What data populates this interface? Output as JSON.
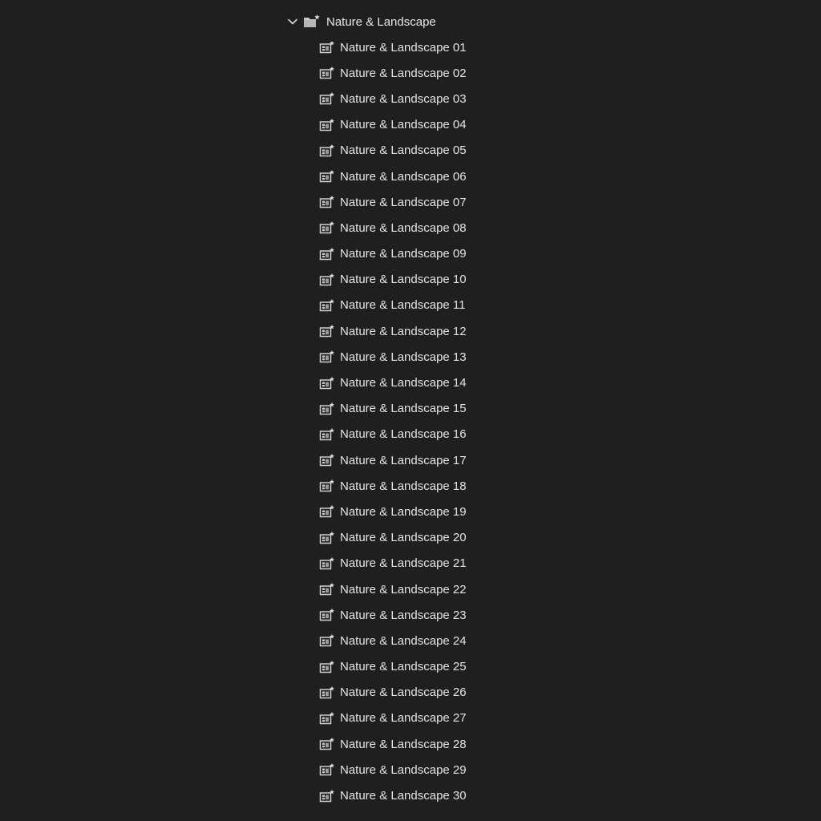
{
  "group": {
    "label": "Nature & Landscape",
    "expanded": true,
    "chevron_icon": "chevron-down-icon",
    "folder_icon": "preset-folder-star-icon"
  },
  "presets": [
    {
      "label": "Nature & Landscape 01"
    },
    {
      "label": "Nature & Landscape 02"
    },
    {
      "label": "Nature & Landscape 03"
    },
    {
      "label": "Nature & Landscape 04"
    },
    {
      "label": "Nature & Landscape 05"
    },
    {
      "label": "Nature & Landscape 06"
    },
    {
      "label": "Nature & Landscape 07"
    },
    {
      "label": "Nature & Landscape 08"
    },
    {
      "label": "Nature & Landscape 09"
    },
    {
      "label": "Nature & Landscape 10"
    },
    {
      "label": "Nature & Landscape 11"
    },
    {
      "label": "Nature & Landscape 12"
    },
    {
      "label": "Nature & Landscape 13"
    },
    {
      "label": "Nature & Landscape 14"
    },
    {
      "label": "Nature & Landscape 15"
    },
    {
      "label": "Nature & Landscape 16"
    },
    {
      "label": "Nature & Landscape 17"
    },
    {
      "label": "Nature & Landscape 18"
    },
    {
      "label": "Nature & Landscape 19"
    },
    {
      "label": "Nature & Landscape 20"
    },
    {
      "label": "Nature & Landscape 21"
    },
    {
      "label": "Nature & Landscape 22"
    },
    {
      "label": "Nature & Landscape 23"
    },
    {
      "label": "Nature & Landscape 24"
    },
    {
      "label": "Nature & Landscape 25"
    },
    {
      "label": "Nature & Landscape 26"
    },
    {
      "label": "Nature & Landscape 27"
    },
    {
      "label": "Nature & Landscape 28"
    },
    {
      "label": "Nature & Landscape 29"
    },
    {
      "label": "Nature & Landscape 30"
    }
  ],
  "preset_icon": "preset-star-icon",
  "colors": {
    "background": "#1f1f1f",
    "text": "#e4e4e4",
    "icon": "#d0d0d0"
  }
}
